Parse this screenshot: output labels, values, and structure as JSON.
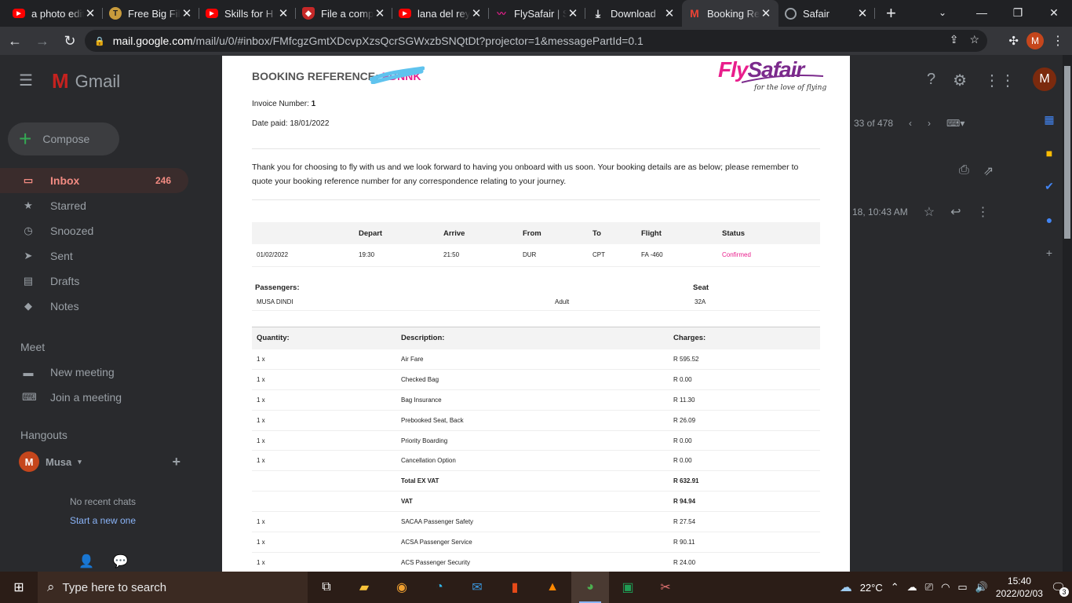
{
  "browser": {
    "tabs": [
      {
        "title": "a photo edit",
        "favicon": "youtube-icon"
      },
      {
        "title": "Free Big Fil",
        "favicon": "t-icon"
      },
      {
        "title": "Skills for H",
        "favicon": "youtube-icon"
      },
      {
        "title": "File a comp",
        "favicon": "shield-icon"
      },
      {
        "title": "lana del rey",
        "favicon": "youtube-icon"
      },
      {
        "title": "FlySafair | S",
        "favicon": "flysafair-icon"
      },
      {
        "title": "Download",
        "favicon": "download-icon"
      },
      {
        "title": "Booking Re",
        "favicon": "gmail-icon",
        "active": true
      },
      {
        "title": "Safair",
        "favicon": "globe-icon"
      }
    ],
    "url_host": "mail.google.com",
    "url_path": "/mail/u/0/#inbox/FMfcgzGmtXDcvpXzsQcrSGWxzbSNQtDt?projector=1&messagePartId=0.1",
    "profile_initial": "M"
  },
  "gmail": {
    "logo_text": "Gmail",
    "compose_label": "Compose",
    "nav": [
      {
        "label": "Inbox",
        "count": "246",
        "icon": "inbox-icon"
      },
      {
        "label": "Starred",
        "icon": "star-icon"
      },
      {
        "label": "Snoozed",
        "icon": "clock-icon"
      },
      {
        "label": "Sent",
        "icon": "send-icon"
      },
      {
        "label": "Drafts",
        "icon": "draft-icon"
      },
      {
        "label": "Notes",
        "icon": "label-icon"
      }
    ],
    "meet_heading": "Meet",
    "meet_items": [
      "New meeting",
      "Join a meeting"
    ],
    "hangouts_heading": "Hangouts",
    "hangouts_user": "Musa",
    "hangouts_user_initial": "M",
    "no_chats": "No recent chats",
    "start_new": "Start a new one",
    "pagination": "33 of 478",
    "mail_time": "18, 10:43 AM",
    "account_initial": "M"
  },
  "invoice": {
    "booking_ref_label": "BOOKING REFERENCE:",
    "booking_ref_code": "PDNNK",
    "logo_fly": "Fly",
    "logo_safair": "Safair",
    "logo_tagline": "for the love of flying",
    "invoice_number_label": "Invoice Number:",
    "invoice_number": "1",
    "date_paid": "Date paid: 18/01/2022",
    "intro": "Thank you for choosing to fly with us and we look forward to having you onboard with us soon. Your booking details are as below; please remember to quote your booking reference number for any correspondence relating to your journey.",
    "flight_headers": [
      "",
      "Depart",
      "Arrive",
      "From",
      "To",
      "Flight",
      "Status"
    ],
    "flights": [
      {
        "date": "01/02/2022",
        "depart": "19:30",
        "arrive": "21:50",
        "from": "DUR",
        "to": "CPT",
        "flight": "FA -460",
        "status": "Confirmed"
      }
    ],
    "pax_headers": {
      "passengers": "Passengers:",
      "seat": "Seat"
    },
    "passengers": [
      {
        "name": "MUSA DINDI",
        "type": "Adult",
        "seat": "32A"
      }
    ],
    "charge_headers": {
      "quantity": "Quantity:",
      "description": "Description:",
      "charges": "Charges:"
    },
    "charges": [
      {
        "qty": "1 x",
        "desc": "Air Fare",
        "amount": "R 595.52"
      },
      {
        "qty": "1 x",
        "desc": "Checked Bag",
        "amount": "R 0.00"
      },
      {
        "qty": "1 x",
        "desc": "Bag Insurance",
        "amount": "R 11.30"
      },
      {
        "qty": "1 x",
        "desc": "Prebooked Seat, Back",
        "amount": "R 26.09"
      },
      {
        "qty": "1 x",
        "desc": "Priority Boarding",
        "amount": "R 0.00"
      },
      {
        "qty": "1 x",
        "desc": "Cancellation Option",
        "amount": "R 0.00"
      },
      {
        "qty": "",
        "desc": "Total EX VAT",
        "amount": "R 632.91",
        "bold": true
      },
      {
        "qty": "",
        "desc": "VAT",
        "amount": "R 94.94",
        "bold": true
      },
      {
        "qty": "1 x",
        "desc": "SACAA Passenger Safety",
        "amount": "R 27.54"
      },
      {
        "qty": "1 x",
        "desc": "ACSA Passenger Service",
        "amount": "R 90.11"
      },
      {
        "qty": "1 x",
        "desc": "ACS Passenger Security",
        "amount": "R 24.00"
      }
    ]
  },
  "taskbar": {
    "search_placeholder": "Type here to search",
    "temperature": "22°C",
    "time": "15:40",
    "date": "2022/02/03",
    "notification_count": "3"
  },
  "colors": {
    "flysafair_pink": "#e91e8c",
    "flysafair_purple": "#7b2a8c"
  }
}
